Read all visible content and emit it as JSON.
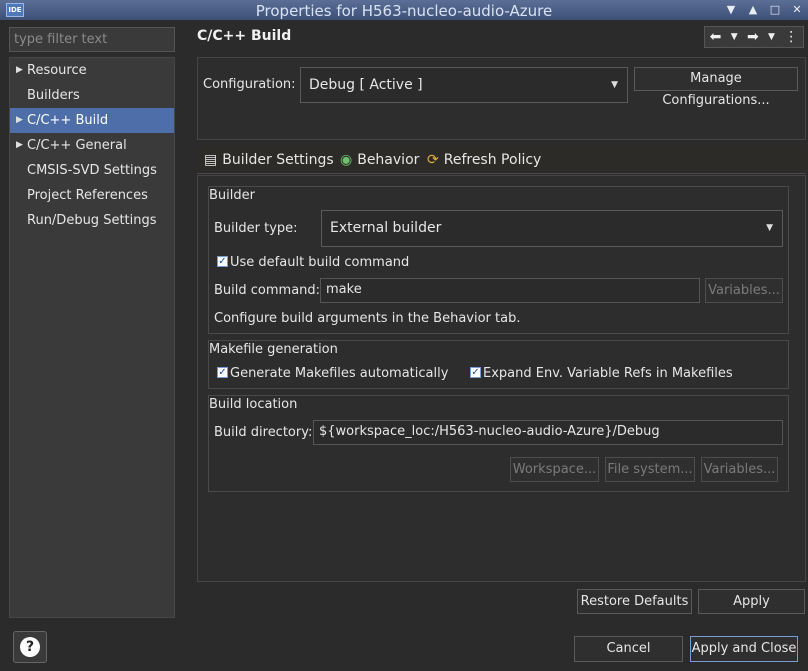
{
  "window": {
    "title": "Properties for H563-nucleo-audio-Azure",
    "app_icon_label": "IDE",
    "controls": [
      "▼",
      "▲",
      "□",
      "✕"
    ]
  },
  "sidebar": {
    "filter_placeholder": "type filter text",
    "items": [
      {
        "label": "Resource",
        "expandable": true,
        "selected": false
      },
      {
        "label": "Builders",
        "expandable": false,
        "selected": false
      },
      {
        "label": "C/C++ Build",
        "expandable": true,
        "selected": true
      },
      {
        "label": "C/C++ General",
        "expandable": true,
        "selected": false
      },
      {
        "label": "CMSIS-SVD Settings",
        "expandable": false,
        "selected": false
      },
      {
        "label": "Project References",
        "expandable": false,
        "selected": false
      },
      {
        "label": "Run/Debug Settings",
        "expandable": false,
        "selected": false
      }
    ],
    "help_label": "?"
  },
  "main": {
    "title": "C/C++ Build",
    "configuration": {
      "label": "Configuration:",
      "value": "Debug  [ Active ]",
      "manage_button": "Manage Configurations..."
    },
    "tabs": [
      {
        "label": "Builder Settings",
        "icon": "builder-settings-icon"
      },
      {
        "label": "Behavior",
        "icon": "behavior-icon"
      },
      {
        "label": "Refresh Policy",
        "icon": "refresh-policy-icon"
      }
    ],
    "builder": {
      "group_title": "Builder",
      "type_label": "Builder type:",
      "type_value": "External builder",
      "use_default_label": "Use default build command",
      "use_default_checked": true,
      "command_label": "Build command:",
      "command_value": "make",
      "variables_button": "Variables...",
      "hint": "Configure build arguments in the Behavior tab."
    },
    "makefile": {
      "group_title": "Makefile generation",
      "generate_label": "Generate Makefiles automatically",
      "generate_checked": true,
      "expand_label": "Expand Env. Variable Refs in Makefiles",
      "expand_checked": true
    },
    "location": {
      "group_title": "Build location",
      "directory_label": "Build directory:",
      "directory_value": "${workspace_loc:/H563-nucleo-audio-Azure}/Debug",
      "workspace_button": "Workspace...",
      "filesystem_button": "File system...",
      "variables_button": "Variables..."
    },
    "restore_defaults_button": "Restore Defaults",
    "apply_button": "Apply"
  },
  "footer": {
    "cancel_button": "Cancel",
    "apply_close_button": "Apply and Close"
  },
  "colors": {
    "background": "#2b2b2b",
    "selection": "#4d6ea8",
    "titlebar": "#4a5d85"
  }
}
